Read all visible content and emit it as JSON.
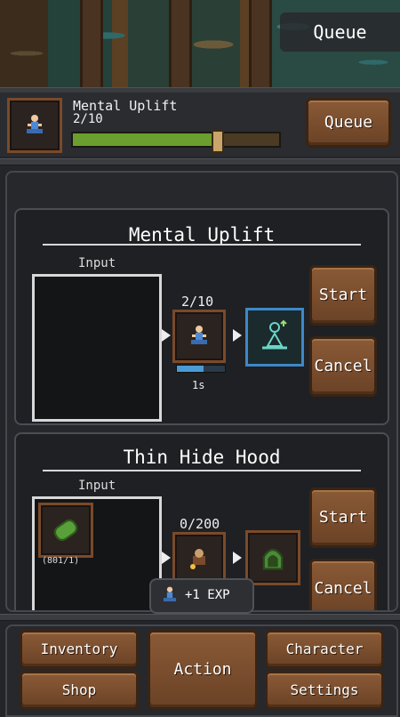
{
  "scene": {
    "queue_label": "Queue"
  },
  "current_task": {
    "title": "Mental Uplift",
    "count": "2/10",
    "progress": 0.7,
    "queue_label": "Queue",
    "icon": "meditation-icon"
  },
  "cards": [
    {
      "title": "Mental Uplift",
      "input_label": "Input",
      "count": "2/10",
      "time": "1s",
      "progress": 0.55,
      "start_label": "Start",
      "cancel_label": "Cancel",
      "icon": "meditation-icon",
      "output_icon": "meditation-glow-icon"
    },
    {
      "title": "Thin Hide Hood",
      "input_label": "Input",
      "input_item_count": "(801/1)",
      "count": "0/200",
      "start_label": "Start",
      "cancel_label": "Cancel",
      "input_icon": "hide-icon",
      "icon": "crafting-icon",
      "output_icon": "hood-icon"
    }
  ],
  "toast": {
    "text": "+1 EXP",
    "icon": "meditation-icon"
  },
  "nav": {
    "inventory": "Inventory",
    "shop": "Shop",
    "action": "Action",
    "character": "Character",
    "settings": "Settings"
  },
  "colors": {
    "button_brown": "#7a4a2a",
    "progress_green": "#6a9e2e",
    "selected_blue": "#3e88c8",
    "panel_dark": "#26282c"
  }
}
